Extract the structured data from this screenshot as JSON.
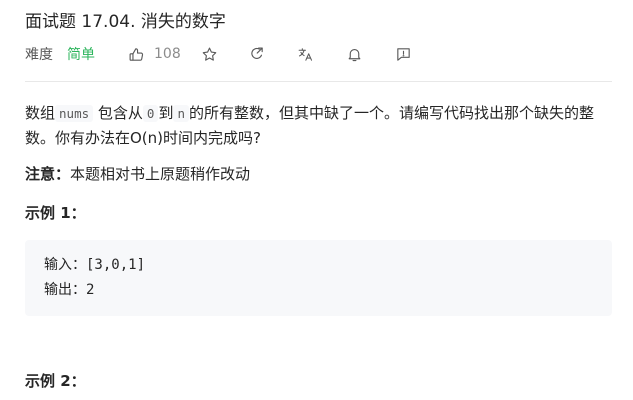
{
  "problem": {
    "title": "面试题 17.04. 消失的数字",
    "difficulty_label": "难度",
    "difficulty_value": "简单",
    "likes": "108"
  },
  "colors": {
    "difficulty_easy": "#2db55d",
    "text": "#262626",
    "muted": "#8c8c8c",
    "code_bg": "#f7f8fa"
  },
  "icons": [
    "thumbs-up-icon",
    "star-icon",
    "share-icon",
    "translate-icon",
    "bell-icon",
    "feedback-icon"
  ],
  "description": {
    "part1": "数组",
    "code_nums": "nums",
    "part2": "包含从",
    "code_zero": "0",
    "part3": "到",
    "code_n": "n",
    "part4": "的所有整数，但其中缺了一个。请编写代码找出那个缺失的整数。你有办法在O(n)时间内完成吗?"
  },
  "note": {
    "label": "注意：",
    "text": "本题相对书上原题稍作改动"
  },
  "examples": [
    {
      "title": "示例 1：",
      "input_line": "输入：[3,0,1]",
      "output_line": "输出：2"
    },
    {
      "title": "示例 2："
    }
  ]
}
